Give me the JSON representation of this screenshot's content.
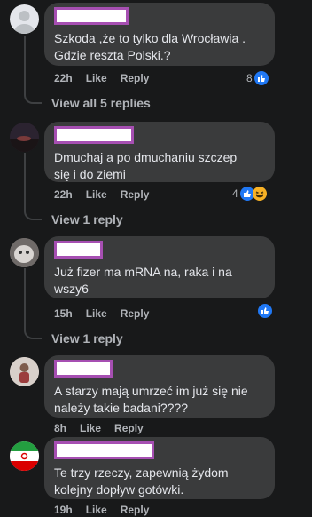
{
  "comments": [
    {
      "text": "Szkoda ,że to tylko dla Wrocławia .\nGdzie reszta Polski.?",
      "time": "22h",
      "like": "Like",
      "reply": "Reply",
      "reaction_count": "8",
      "reactions": [
        "like"
      ],
      "view_replies": "View all 5 replies"
    },
    {
      "text": "Dmuchaj a po dmuchaniu szczep\nsię i do ziemi",
      "time": "22h",
      "like": "Like",
      "reply": "Reply",
      "reaction_count": "4",
      "reactions": [
        "like",
        "haha"
      ],
      "view_replies": "View 1 reply"
    },
    {
      "text": "Już fizer ma mRNA na, raka i na\nwszy6",
      "time": "15h",
      "like": "Like",
      "reply": "Reply",
      "reaction_count": "",
      "reactions": [
        "like"
      ],
      "view_replies": "View 1 reply"
    },
    {
      "text": "A starzy mają umrzeć im już się nie\nnależy takie badani????",
      "time": "8h",
      "like": "Like",
      "reply": "Reply",
      "reaction_count": "",
      "reactions": [],
      "view_replies": ""
    },
    {
      "text": "Te trzy rzeczy, zapewnią żydom\nkolejny dopływ gotówki.",
      "time": "19h",
      "like": "Like",
      "reply": "Reply",
      "reaction_count": "",
      "reactions": [],
      "view_replies": ""
    }
  ],
  "colors": {
    "background": "#18191a",
    "bubble": "#3a3b3c",
    "redaction_border": "#a64fb2",
    "like_blue": "#2078f4"
  }
}
